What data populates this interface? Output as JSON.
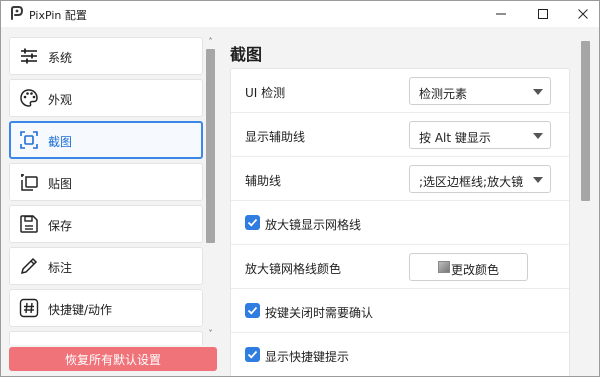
{
  "window": {
    "title": "PixPin 配置",
    "controls": {
      "minimize": "minimize",
      "maximize": "maximize",
      "close": "close"
    }
  },
  "sidebar": {
    "items": [
      {
        "label": "系统",
        "icon": "sliders-icon",
        "active": false
      },
      {
        "label": "外观",
        "icon": "palette-icon",
        "active": false
      },
      {
        "label": "截图",
        "icon": "screenshot-icon",
        "active": true
      },
      {
        "label": "贴图",
        "icon": "pin-image-icon",
        "active": false
      },
      {
        "label": "保存",
        "icon": "save-icon",
        "active": false
      },
      {
        "label": "标注",
        "icon": "pen-icon",
        "active": false
      },
      {
        "label": "快捷键/动作",
        "icon": "hash-icon",
        "active": false
      }
    ],
    "reset_label": "恢复所有默认设置",
    "scroll_up": "˄",
    "scroll_down": "˅"
  },
  "main": {
    "title": "截图",
    "settings": [
      {
        "type": "select",
        "label": "UI 检测",
        "value": "检测元素"
      },
      {
        "type": "select",
        "label": "显示辅助线",
        "value": "按 Alt 键显示"
      },
      {
        "type": "select",
        "label": "辅助线",
        "value": ";选区边框线;放大镜"
      },
      {
        "type": "checkbox",
        "label": "放大镜显示网格线",
        "checked": true
      },
      {
        "type": "button",
        "label": "放大镜网格线颜色",
        "button_label": "更改颜色"
      },
      {
        "type": "checkbox",
        "label": "按键关闭时需要确认",
        "checked": true
      },
      {
        "type": "checkbox",
        "label": "显示快捷键提示",
        "checked": true
      }
    ]
  },
  "colors": {
    "accent": "#3b86e6",
    "checkbox": "#2f7de1",
    "reset_button": "#f0737a"
  }
}
